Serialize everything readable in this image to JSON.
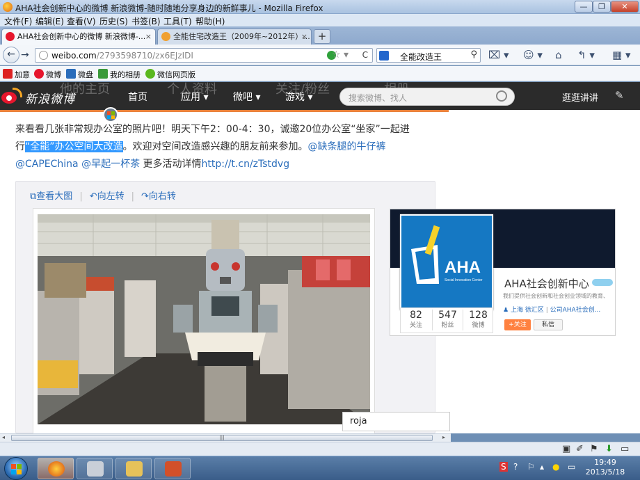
{
  "window": {
    "title": "AHA社会创新中心的微博 新浪微博-随时随地分享身边的新鲜事儿 - Mozilla Firefox",
    "min": "—",
    "max": "❐",
    "close": "✕"
  },
  "menu": [
    "文件(F)",
    "编辑(E)",
    "查看(V)",
    "历史(S)",
    "书签(B)",
    "工具(T)",
    "帮助(H)"
  ],
  "tabs": [
    {
      "label": "AHA社会创新中心的微博 新浪微博-...",
      "close": "×"
    },
    {
      "label": "全能住宅改造王（2009年~2012年）...",
      "close": "×"
    }
  ],
  "new_tab": "+",
  "nav": {
    "url_host": "weibo.com",
    "url_path": "/2793598710/zx6EJzIDI",
    "search_value": "全能改造王"
  },
  "bookmarks": [
    "加意",
    "微博",
    "微盘",
    "我的相册",
    "微信网页版"
  ],
  "weibo": {
    "logo_text": "新浪微博",
    "ghost_links": [
      "他的主页",
      "个人资料",
      "关注/粉丝",
      "相册"
    ],
    "nav": [
      "首页",
      "应用 ▾",
      "微吧 ▾",
      "游戏 ▾"
    ],
    "search_placeholder": "搜索微博、找人",
    "user_link": "逛逛讲讲",
    "edit_icon": "✎"
  },
  "post": {
    "line1": "来看看几张非常规办公室的照片吧！明天下午2：00-4：30，诚邀20位办公室“坐家”一起进",
    "line2_pre": "行",
    "line2_highlight": "“全能”办公空间大改造",
    "line2_post": "。欢迎对空间改造感兴趣的朋友前来参加。",
    "mention1": "@缺条腿的牛仔裤",
    "mention2": "@CAPEChina",
    "mention3": "@早起一杯茶",
    "more_text": " 更多活动详情",
    "link": "http://t.cn/zTstdvg"
  },
  "media": {
    "view_large": "查看大图",
    "rotate_left": "向左转",
    "rotate_right": "向右转",
    "sep": "|"
  },
  "profile": {
    "name": "AHA社会创新中心",
    "logo_text": "AHA",
    "logo_sub": "Social Innovation Center",
    "desc": "我们提供社会创新和社会创业领域的教育、",
    "location": "上海 徐汇区",
    "company": "公司AHA社会创...",
    "follow": "+关注",
    "message": "私信",
    "stats": [
      {
        "n": "82",
        "l": "关注"
      },
      {
        "n": "547",
        "l": "粉丝"
      },
      {
        "n": "128",
        "l": "微博"
      }
    ]
  },
  "tooltip": "roja",
  "scroll_grip": "|||",
  "clock": {
    "time": "19:49",
    "date": "2013/5/18"
  }
}
